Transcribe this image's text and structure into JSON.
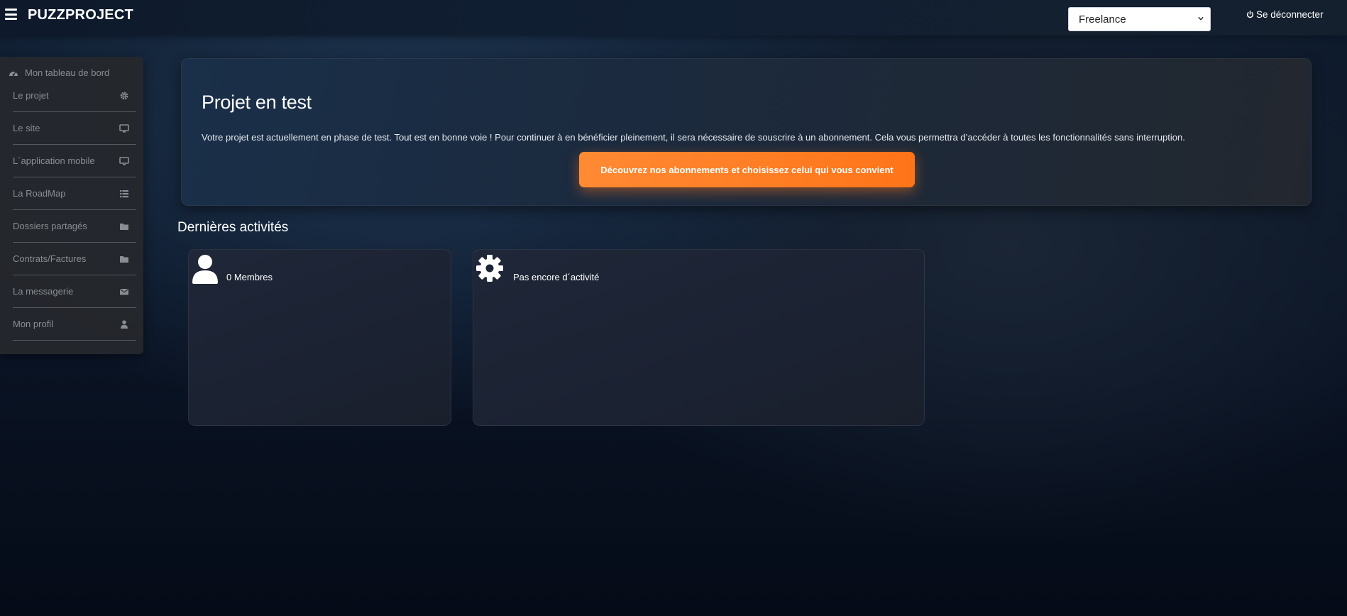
{
  "header": {
    "brand": "PUZZPROJECT",
    "role_selected": "Freelance",
    "role_options": [
      "Freelance"
    ],
    "logout_label": "Se déconnecter"
  },
  "sidebar": {
    "dashboard_label": "Mon tableau de bord",
    "items": [
      {
        "label": "Le projet",
        "icon": "gear-icon"
      },
      {
        "label": "Le site",
        "icon": "desktop-icon"
      },
      {
        "label": "L´application mobile",
        "icon": "desktop-icon"
      },
      {
        "label": "La RoadMap",
        "icon": "list-icon"
      },
      {
        "label": "Dossiers partagés",
        "icon": "folder-icon"
      },
      {
        "label": "Contrats/Factures",
        "icon": "folder-icon"
      },
      {
        "label": "La messagerie",
        "icon": "envelope-icon"
      },
      {
        "label": "Mon profil",
        "icon": "user-icon"
      }
    ]
  },
  "banner": {
    "title": "Projet en test",
    "text": "Votre projet est actuellement en phase de test. Tout est en bonne voie ! Pour continuer à en bénéficier pleinement, il sera nécessaire de souscrire à un abonnement. Cela vous permettra d’accéder à toutes les fonctionnalités sans interruption.",
    "cta_label": "Découvrez nos abonnements et choisissez celui qui vous convient"
  },
  "activities": {
    "title": "Dernières activités",
    "members_text": "0 Membres",
    "activity_text": "Pas encore d´activité"
  },
  "colors": {
    "accent_orange": "#ff7a1f",
    "sidebar_text": "#8a8d92",
    "background_dark": "#0b1526"
  }
}
